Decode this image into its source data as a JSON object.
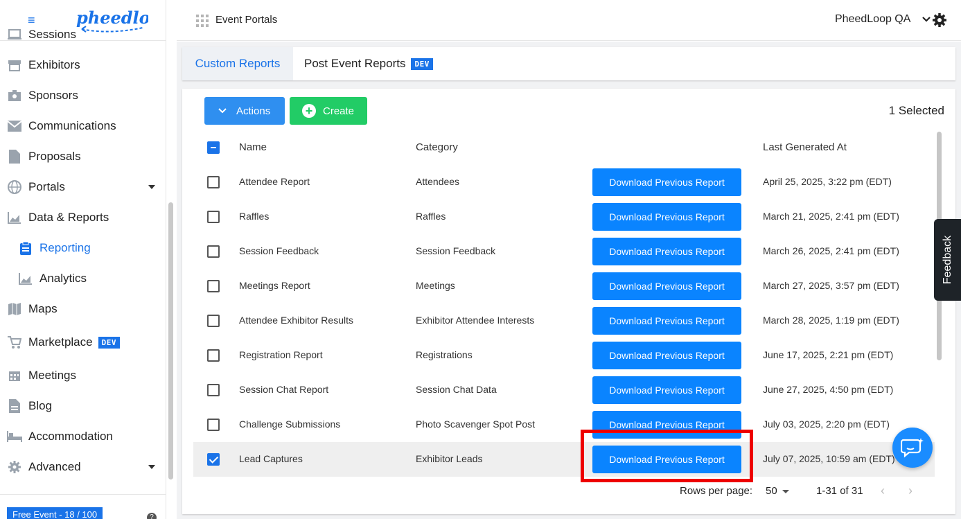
{
  "sidebar": {
    "logo_text": "pheedloop",
    "items": [
      {
        "label": "Sessions",
        "icon": "monitor-icon"
      },
      {
        "label": "Exhibitors",
        "icon": "store-icon"
      },
      {
        "label": "Sponsors",
        "icon": "badge-icon"
      },
      {
        "label": "Communications",
        "icon": "mail-icon"
      },
      {
        "label": "Proposals",
        "icon": "document-icon"
      },
      {
        "label": "Portals",
        "icon": "globe-icon"
      },
      {
        "label": "Data & Reports",
        "icon": "chart-icon"
      },
      {
        "label": "Reporting",
        "icon": "clipboard-icon"
      },
      {
        "label": "Analytics",
        "icon": "chart-icon"
      },
      {
        "label": "Maps",
        "icon": "map-icon"
      },
      {
        "label": "Marketplace",
        "icon": "cart-icon",
        "badge": "DEV"
      },
      {
        "label": "Meetings",
        "icon": "calendar-icon"
      },
      {
        "label": "Blog",
        "icon": "document-icon"
      },
      {
        "label": "Accommodation",
        "icon": "bed-icon"
      },
      {
        "label": "Advanced",
        "icon": "gear-icon"
      }
    ],
    "footer_badge": "Free Event - 18 / 100"
  },
  "topbar": {
    "title": "Event Portals",
    "account": "PheedLoop QA"
  },
  "tabs": [
    {
      "label": "Custom Reports"
    },
    {
      "label": "Post Event Reports",
      "badge": "DEV"
    }
  ],
  "toolbar": {
    "actions_label": "Actions",
    "create_label": "Create",
    "selected_count": "1 Selected"
  },
  "table": {
    "headers": {
      "name": "Name",
      "category": "Category",
      "last_generated": "Last Generated At"
    },
    "button_label": "Download Previous Report",
    "rows": [
      {
        "name": "Attendee Report",
        "category": "Attendees",
        "date": "April 25, 2025, 3:22 pm (EDT)",
        "checked": false
      },
      {
        "name": "Raffles",
        "category": "Raffles",
        "date": "March 21, 2025, 2:41 pm (EDT)",
        "checked": false
      },
      {
        "name": "Session Feedback",
        "category": "Session Feedback",
        "date": "March 26, 2025, 2:41 pm (EDT)",
        "checked": false
      },
      {
        "name": "Meetings Report",
        "category": "Meetings",
        "date": "March 27, 2025, 3:57 pm (EDT)",
        "checked": false
      },
      {
        "name": "Attendee Exhibitor Results",
        "category": "Exhibitor Attendee Interests",
        "date": "March 28, 2025, 1:19 pm (EDT)",
        "checked": false
      },
      {
        "name": "Registration Report",
        "category": "Registrations",
        "date": "June 17, 2025, 2:21 pm (EDT)",
        "checked": false
      },
      {
        "name": "Session Chat Report",
        "category": "Session Chat Data",
        "date": "June 27, 2025, 4:50 pm (EDT)",
        "checked": false
      },
      {
        "name": "Challenge Submissions",
        "category": "Photo Scavenger Spot Post",
        "date": "July 03, 2025, 2:20 pm (EDT)",
        "checked": false
      },
      {
        "name": "Lead Captures",
        "category": "Exhibitor Leads",
        "date": "July 07, 2025, 10:59 am (EDT)",
        "checked": true
      }
    ]
  },
  "pager": {
    "rows_per_page_label": "Rows per page:",
    "rows_per_page": "50",
    "range": "1-31 of 31"
  },
  "feedback_label": "Feedback",
  "colors": {
    "primary": "#1a73e8",
    "button_blue": "#0a84ff",
    "create_green": "#22cc66",
    "highlight": "#ee0000"
  }
}
